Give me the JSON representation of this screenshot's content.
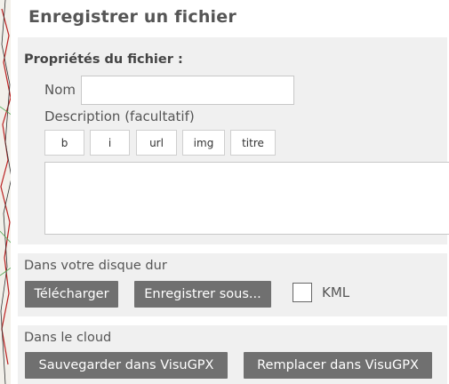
{
  "dialog": {
    "title": "Enregistrer un fichier"
  },
  "properties": {
    "title": "Propriétés du fichier :",
    "name_label": "Nom",
    "name_value": "",
    "description_label": "Description (facultatif)",
    "description_value": "",
    "format_buttons": [
      "b",
      "i",
      "url",
      "img",
      "titre"
    ]
  },
  "disk": {
    "title": "Dans votre disque dur",
    "download_label": "Télécharger",
    "save_as_label": "Enregistrer sous...",
    "kml_label": "KML",
    "kml_checked": false
  },
  "cloud": {
    "title": "Dans le cloud",
    "save_label": "Sauvegarder dans VisuGPX",
    "replace_label": "Remplacer dans VisuGPX"
  },
  "colors": {
    "button_bg": "#707070",
    "section_bg": "#f0f0f0",
    "title_color": "#555555"
  }
}
